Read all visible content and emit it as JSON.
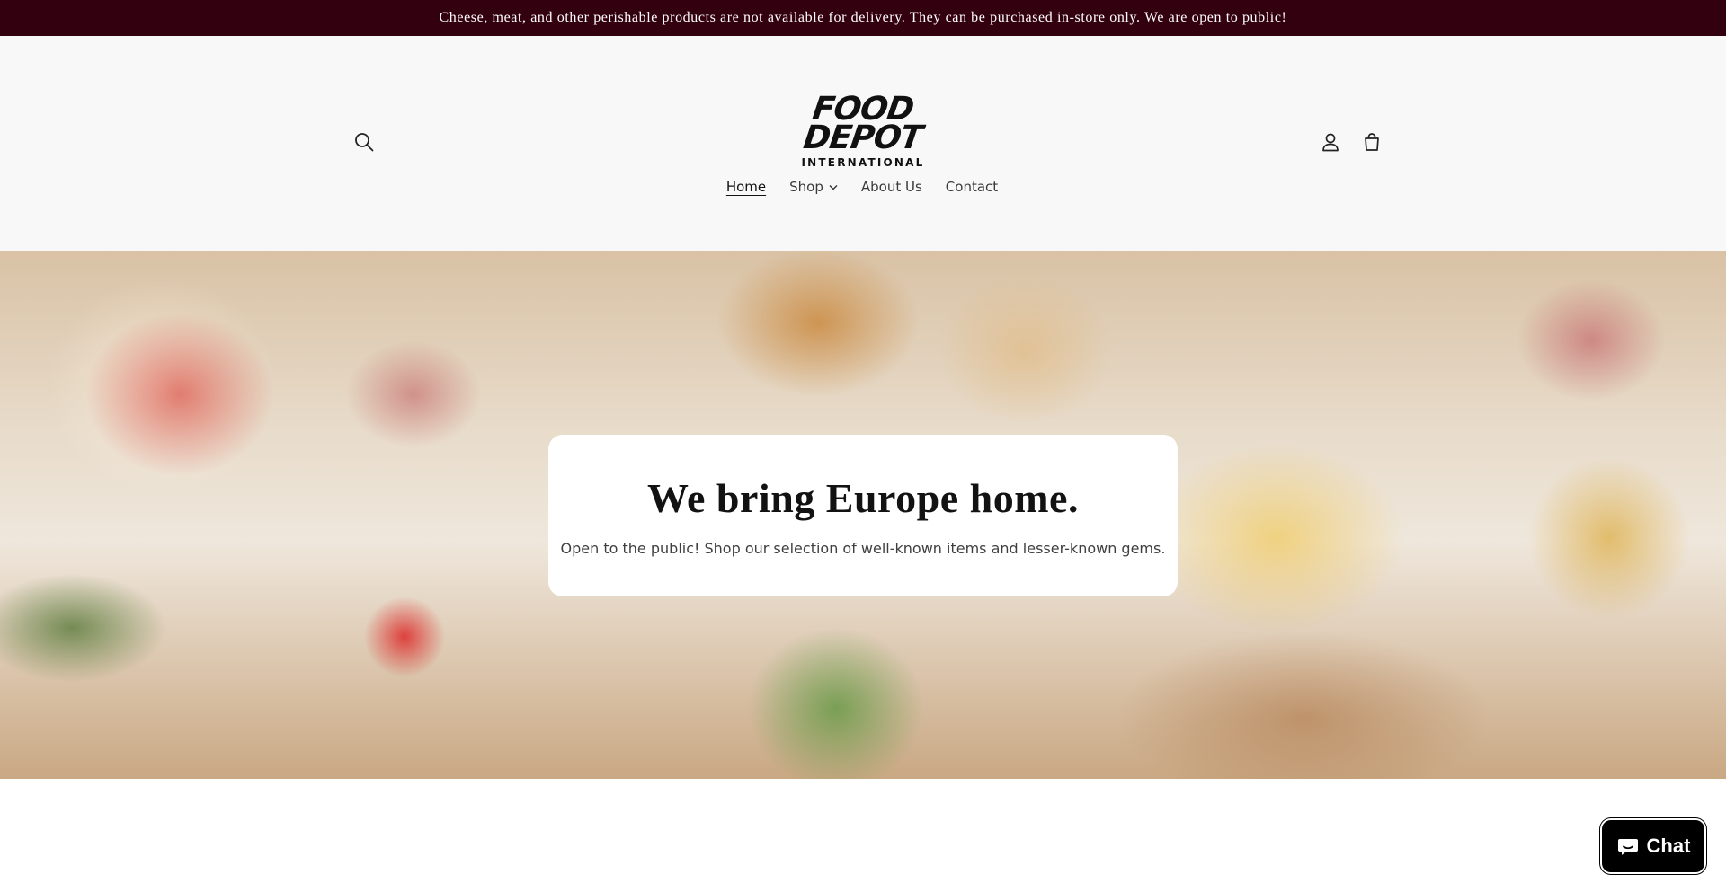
{
  "announcement": {
    "text": "Cheese, meat, and other perishable products are not available for delivery. They can be purchased in-store only. We are open to public!"
  },
  "header": {
    "logo": {
      "line1": "FOOD",
      "line2": "DEPOT",
      "line3": "INTERNATIONAL"
    },
    "icons": {
      "search": "search-icon",
      "account": "user-icon",
      "cart": "cart-icon"
    }
  },
  "nav": {
    "items": [
      {
        "label": "Home",
        "active": true
      },
      {
        "label": "Shop",
        "has_dropdown": true
      },
      {
        "label": "About Us"
      },
      {
        "label": "Contact"
      }
    ]
  },
  "hero": {
    "title": "We bring Europe home.",
    "subtitle": "Open to the public! Shop our selection of well-known items and lesser-known gems."
  },
  "chat": {
    "label": "Chat",
    "icon": "chat-bubble-icon"
  },
  "colors": {
    "announcement_bg": "#33000f",
    "header_bg": "#f8f8f8",
    "chat_bg": "#000000"
  }
}
